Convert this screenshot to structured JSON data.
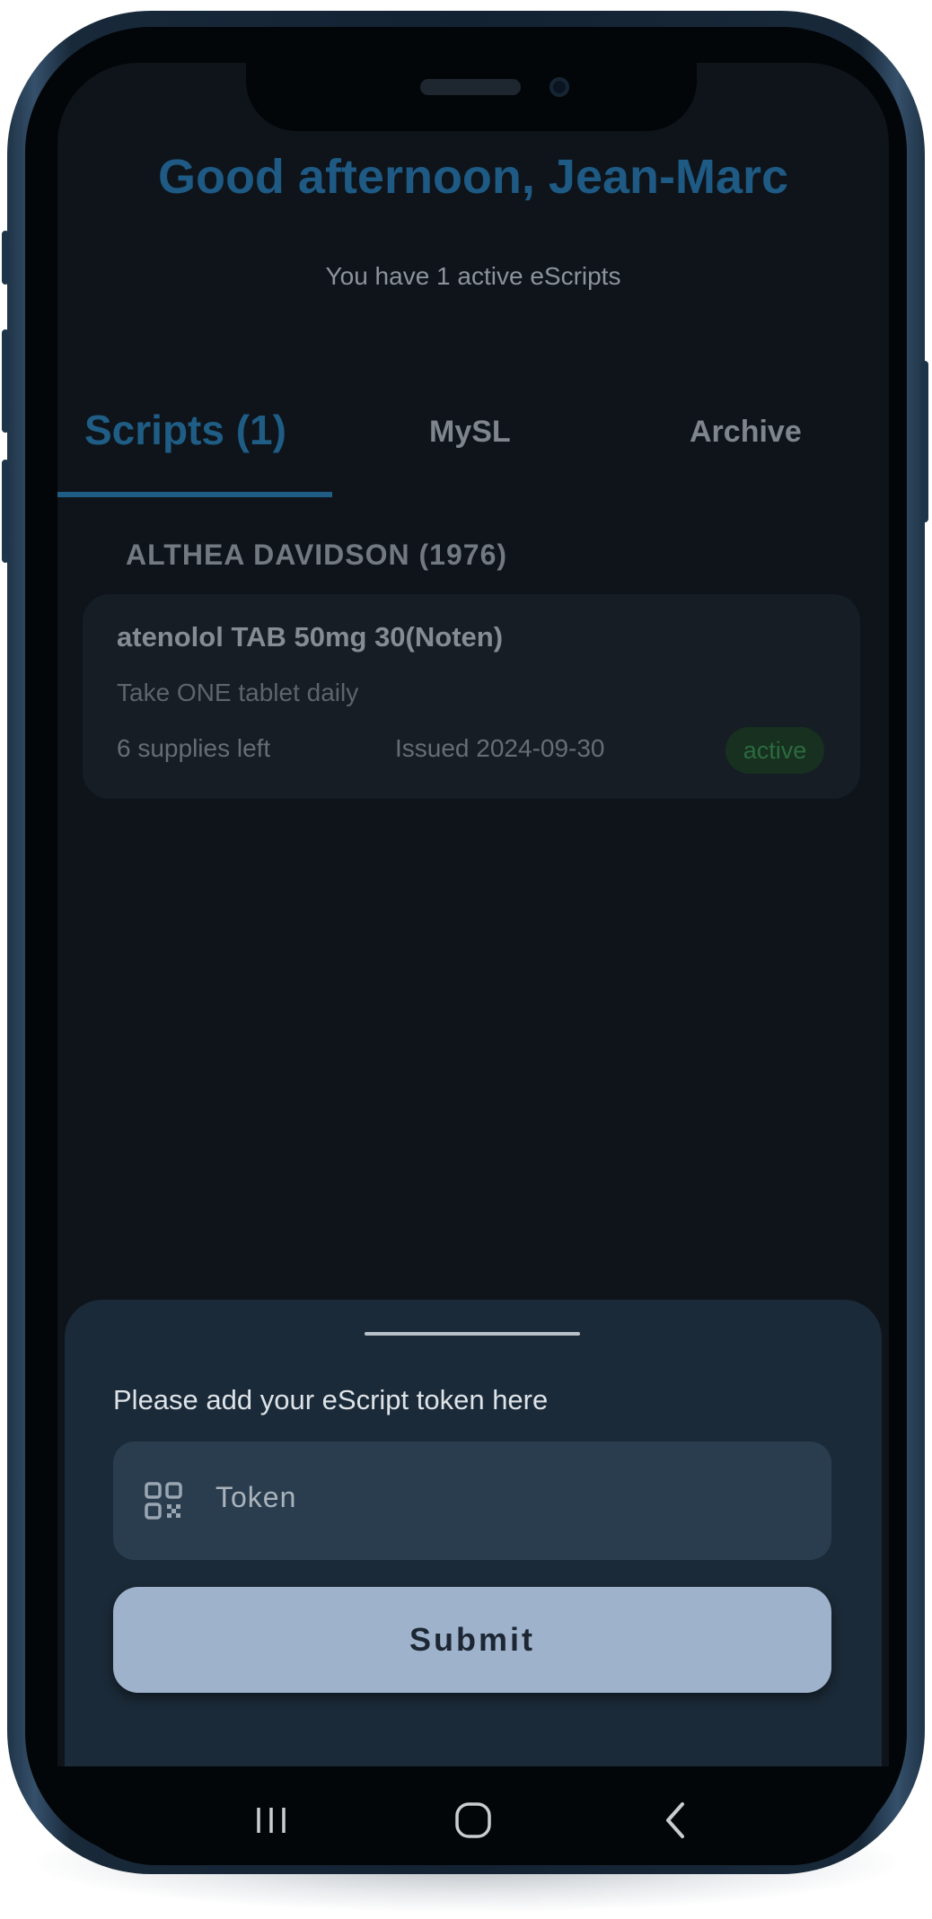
{
  "header": {
    "greeting": "Good afternoon, Jean-Marc",
    "subtitle": "You have 1 active eScripts"
  },
  "tabs": [
    {
      "label": "Scripts (1)",
      "active": true
    },
    {
      "label": "MySL",
      "active": false
    },
    {
      "label": "Archive",
      "active": false
    }
  ],
  "patient": {
    "name": "ALTHEA DAVIDSON (1976)"
  },
  "script_card": {
    "drug": "atenolol TAB 50mg 30(Noten)",
    "instructions": "Take ONE tablet daily",
    "supplies": "6 supplies left",
    "issued": "Issued 2024-09-30",
    "status": "active"
  },
  "token_sheet": {
    "prompt": "Please add your eScript token here",
    "token_placeholder": "Token",
    "token_icon": "qr-code-icon",
    "submit_label": "Submit"
  },
  "navbar": {
    "icons": [
      "recent-apps-icon",
      "home-icon",
      "back-icon"
    ]
  },
  "colors": {
    "accent": "#1f5d85",
    "active_badge": "#2c6a3e",
    "submit_bg": "#9fb2cc"
  }
}
